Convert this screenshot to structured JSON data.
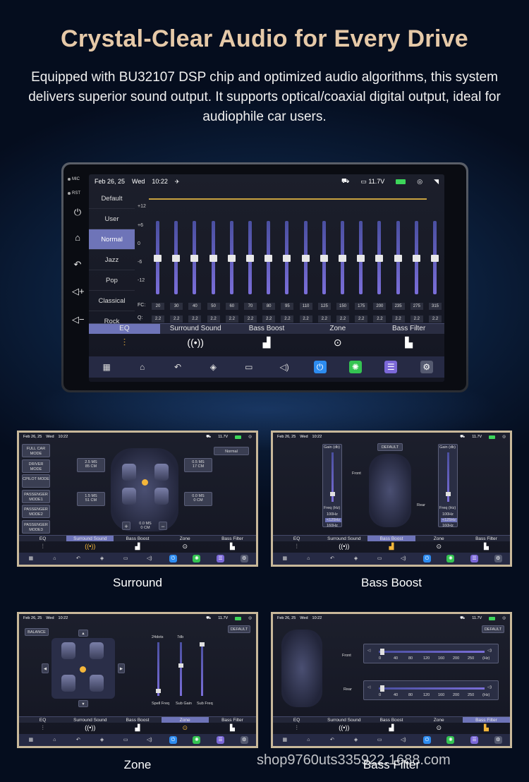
{
  "hero": {
    "title": "Crystal-Clear Audio for Every Drive",
    "description": "Equipped with BU32107 DSP chip and optimized audio algorithms, this system delivers superior sound output. It supports optical/coaxial digital output, ideal for audiophile car users."
  },
  "bezel": {
    "mic": "MIC",
    "rst": "RST"
  },
  "status": {
    "date": "Feb 26, 25",
    "day": "Wed",
    "time": "10:22",
    "voltage": "11.7V"
  },
  "presets": [
    "Default",
    "User",
    "Normal",
    "Jazz",
    "Pop",
    "Classical",
    "Rock"
  ],
  "active_preset": "Normal",
  "eq": {
    "scale": [
      "+12",
      "+6",
      "0",
      "-6",
      "-12"
    ],
    "fc_label": "FC:",
    "q_label": "Q:",
    "frequencies": [
      "20",
      "30",
      "40",
      "50",
      "60",
      "70",
      "80",
      "95",
      "110",
      "125",
      "150",
      "175",
      "200",
      "235",
      "275",
      "315"
    ],
    "q_values": [
      "2.2",
      "2.2",
      "2.2",
      "2.2",
      "2.2",
      "2.2",
      "2.2",
      "2.2",
      "2.2",
      "2.2",
      "2.2",
      "2.2",
      "2.2",
      "2.2",
      "2.2",
      "2.2"
    ],
    "gains_db": [
      0,
      0,
      0,
      0,
      0,
      0,
      0,
      0,
      0,
      0,
      0,
      0,
      0,
      0,
      0,
      0
    ]
  },
  "tabs": [
    "EQ",
    "Surround Sound",
    "Bass Boost",
    "Zone",
    "Bass Filter"
  ],
  "tab_icons": [
    "equalizer-icon",
    "surround-icon",
    "bass-boost-icon",
    "zone-icon",
    "bass-filter-icon"
  ],
  "dock_icons": [
    "apps-icon",
    "home-icon",
    "back-icon",
    "layers-icon",
    "screen-icon",
    "volume-icon",
    "power-icon",
    "brightness-icon",
    "settings-toggle-icon",
    "gear-icon"
  ],
  "panels": {
    "surround": {
      "caption": "Surround",
      "modes": [
        "FULL CAR MODE",
        "DRIVER MODE",
        "CPILOT MODE",
        "PASSENGER MODE1",
        "PASSENGER MODE2",
        "PASSENGER MODE3"
      ],
      "preset": "Normal",
      "delays": [
        {
          "ms": "2.5 MS",
          "cm": "85 CM"
        },
        {
          "ms": "0.5 MS",
          "cm": "17 CM"
        },
        {
          "ms": "1.5 MS",
          "cm": "51 CM"
        },
        {
          "ms": "0.0 MS",
          "cm": "0 CM"
        },
        {
          "ms": "0.0 MS",
          "cm": "0 CM"
        }
      ],
      "plus": "+",
      "minus": "−"
    },
    "bass_boost": {
      "caption": "Bass Boost",
      "preset": "DEFAULT",
      "front": "Front",
      "rear": "Rear",
      "gain_label": "Gain (db)",
      "freq_label": "Freq (Hz)",
      "freqs": [
        "100Hz",
        "<125Hz",
        "160Hz"
      ]
    },
    "zone": {
      "caption": "Zone",
      "balance": "BALANCE",
      "preset": "DEFAULT",
      "slider_labels": [
        "Spell Freq",
        "Sub Gain",
        "Sub Freq"
      ],
      "slider_tops": [
        "24dots",
        "7db",
        ""
      ]
    },
    "bass_filter": {
      "caption": "Bass Filter",
      "preset": "DEFAULT",
      "front": "Front",
      "rear": "Rear",
      "ticks": [
        "0",
        "40",
        "80",
        "120",
        "160",
        "200",
        "250",
        "(Hz)"
      ]
    }
  },
  "watermark": "shop9760uts335922.1688.com"
}
